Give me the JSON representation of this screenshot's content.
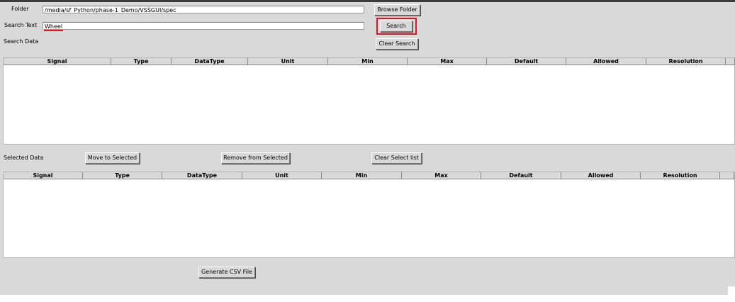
{
  "folder": {
    "label": "Folder",
    "value": "/media/sf_Python/phase-1_Demo/VSSGUI/spec",
    "browse_label": "Browse Folder"
  },
  "search": {
    "label": "Search Text",
    "value": "Wheel",
    "button_label": "Search",
    "clear_label": "Clear Search"
  },
  "search_data": {
    "label": "Search Data",
    "columns": [
      "Signal",
      "Type",
      "DataType",
      "Unit",
      "Min",
      "Max",
      "Default",
      "Allowed",
      "Resolution"
    ]
  },
  "selected_data": {
    "label": "Selected Data",
    "move_label": "Move to Selected",
    "remove_label": "Remove from Selected",
    "clear_label": "Clear Select list",
    "columns": [
      "Signal",
      "Type",
      "DataType",
      "Unit",
      "Min",
      "Max",
      "Default",
      "Allowed",
      "Resolution"
    ]
  },
  "generate_label": "Generate CSV File",
  "colors": {
    "highlight": "#e0141e",
    "background": "#d9d9d9"
  }
}
